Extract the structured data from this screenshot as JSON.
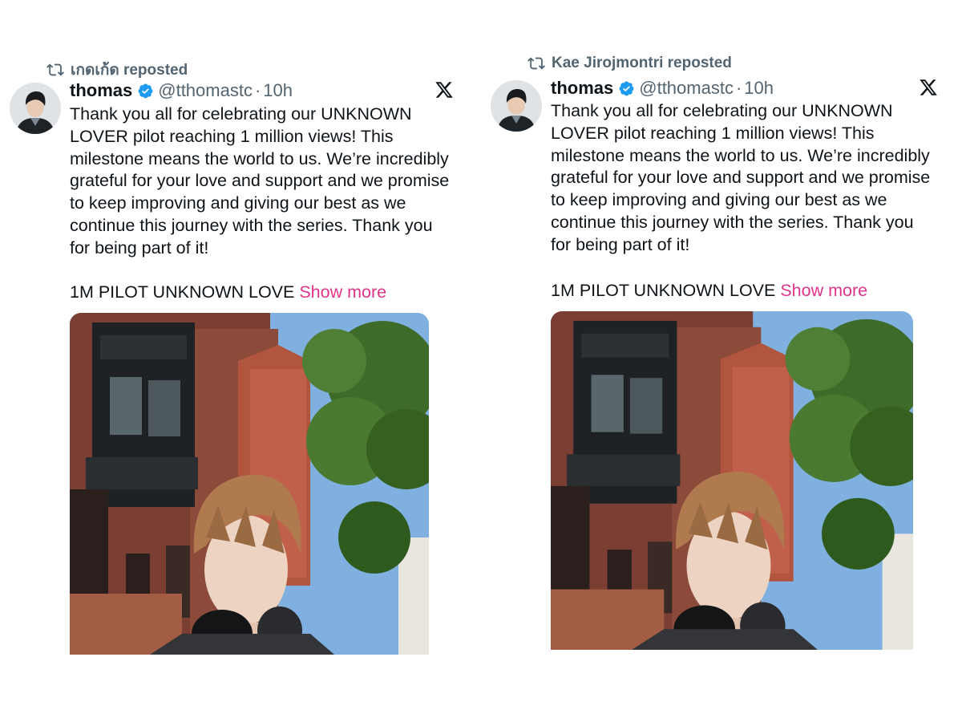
{
  "left": {
    "repost_text": "เกดเก้ด reposted",
    "author": {
      "name": "thomas",
      "handle": "@tthomastc",
      "separator": "·",
      "time": "10h",
      "verified": true
    },
    "body": "Thank you all for celebrating our UNKNOWN\nLOVER pilot reaching 1 million views! This\nmilestone means the world to us. We’re incredibly\ngrateful for your love and support and we promise\nto keep improving and giving our best as we\ncontinue this journey with the series. Thank you\nfor being part of it!",
    "tagline": "1M PILOT UNKNOWN LOVE",
    "show_more": "Show more"
  },
  "right": {
    "repost_text": "Kae Jirojmontri reposted",
    "author": {
      "name": "thomas",
      "handle": "@tthomastc",
      "separator": "·",
      "time": "10h",
      "verified": true
    },
    "body": "Thank you all for celebrating our UNKNOWN\nLOVER pilot reaching 1 million views! This\nmilestone means the world to us. We’re incredibly\ngrateful for your love and support and we promise\nto keep improving and giving our best as we\ncontinue this journey with the series. Thank you\nfor being part of it!",
    "tagline": "1M PILOT UNKNOWN LOVE",
    "show_more": "Show more"
  },
  "icons": {
    "repost": "repost-icon",
    "verified": "verified-badge-icon",
    "platform": "x-logo-icon"
  },
  "colors": {
    "text": "#0f1419",
    "secondary": "#536471",
    "verified": "#1d9bf0",
    "show_more": "#e0338a"
  }
}
